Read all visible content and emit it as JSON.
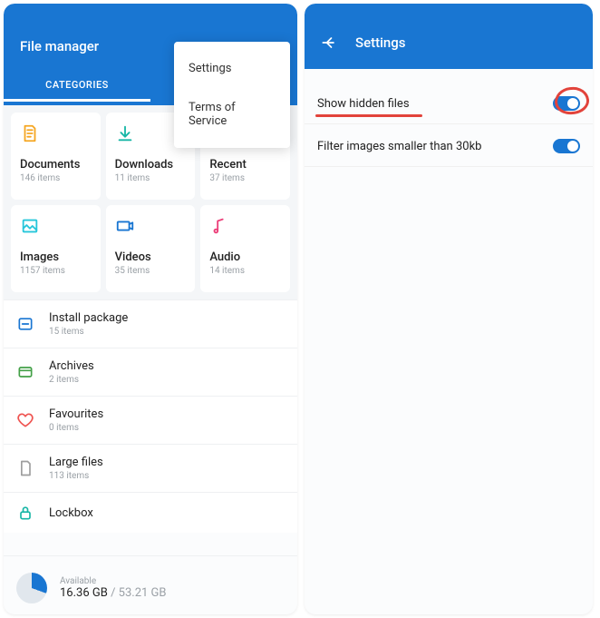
{
  "left": {
    "title": "File manager",
    "tab": "CATEGORIES",
    "menu": {
      "settings": "Settings",
      "terms": "Terms of Service"
    },
    "tiles": [
      {
        "label": "Documents",
        "sub": "146 items"
      },
      {
        "label": "Downloads",
        "sub": "11 items"
      },
      {
        "label": "Recent",
        "sub": "37 items"
      },
      {
        "label": "Images",
        "sub": "1157 items"
      },
      {
        "label": "Videos",
        "sub": "35 items"
      },
      {
        "label": "Audio",
        "sub": "14 items"
      }
    ],
    "rows": [
      {
        "label": "Install package",
        "sub": "15 items"
      },
      {
        "label": "Archives",
        "sub": "2 items"
      },
      {
        "label": "Favourites",
        "sub": "0 items"
      },
      {
        "label": "Large files",
        "sub": "113 items"
      },
      {
        "label": "Lockbox",
        "sub": ""
      }
    ],
    "storage": {
      "label": "Available",
      "used": "16.36 GB",
      "sep": " / ",
      "total": "53.21 GB"
    }
  },
  "right": {
    "title": "Settings",
    "items": [
      {
        "label": "Show hidden files",
        "on": true,
        "highlight": true
      },
      {
        "label": "Filter images smaller than 30kb",
        "on": true,
        "highlight": false
      }
    ]
  }
}
